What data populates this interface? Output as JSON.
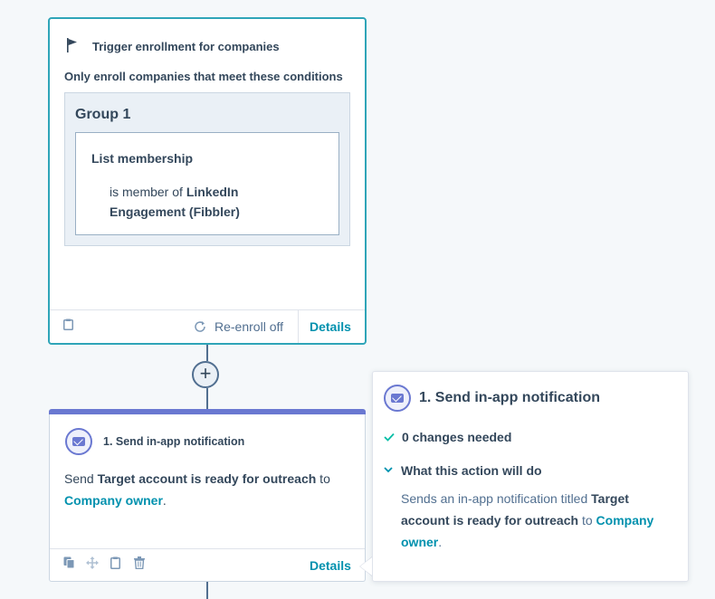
{
  "trigger": {
    "title": "Trigger enrollment for companies",
    "subtitle": "Only enroll companies that meet these conditions",
    "group_title": "Group 1",
    "filter_title": "List membership",
    "filter_prefix": "is member of ",
    "filter_value_line1": "LinkedIn",
    "filter_value_line2": "Engagement (Fibbler)",
    "reenroll_label": "Re-enroll off",
    "details_label": "Details"
  },
  "add_button": {
    "label": "+"
  },
  "action": {
    "title": "1. Send in-app notification",
    "send_prefix": "Send ",
    "notification_title": "Target account is ready for outreach",
    "to_text": " to",
    "recipient": "Company owner",
    "period": ".",
    "details_label": "Details"
  },
  "popover": {
    "title": "1. Send in-app notification",
    "changes_label": "0 changes needed",
    "section_label": "What this action will do",
    "desc_prefix": "Sends an in-app notification titled ",
    "desc_title_1": "Target",
    "desc_title_2": "account is ready for outreach",
    "desc_to": " to ",
    "desc_recipient_1": "Company",
    "desc_recipient_2": "owner",
    "desc_period": "."
  },
  "colors": {
    "accent_teal": "#2fa5b8",
    "link": "#0091ae",
    "action_purple": "#6a78d1",
    "text": "#33475b",
    "background": "#f5f8fa",
    "success": "#00bda5"
  },
  "icons": [
    "flag-icon",
    "clipboard-icon",
    "refresh-icon",
    "envelope-icon",
    "copy-icon",
    "move-icon",
    "trash-icon",
    "check-icon",
    "chevron-down-icon",
    "plus-icon"
  ]
}
